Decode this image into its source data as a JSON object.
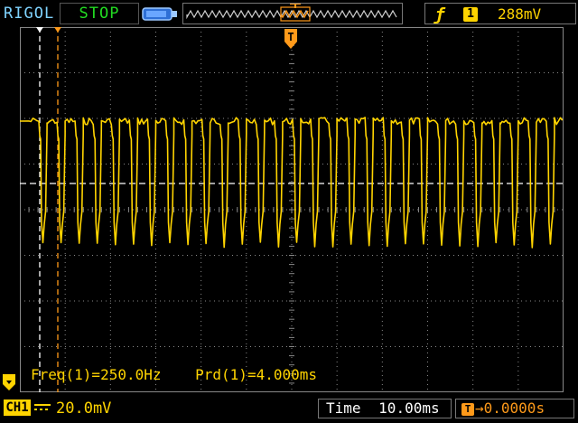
{
  "header": {
    "brand": "RIGOL",
    "run_state": "STOP",
    "trigger_slope_icon": "rising-edge-icon",
    "trigger_source": "1",
    "trigger_level": "288mV"
  },
  "screen_markers": {
    "trigger_position_label": "T"
  },
  "measurements": [
    "Freq(1)=250.0Hz",
    "Prd(1)=4.000ms"
  ],
  "footer": {
    "channel_label": "CH1",
    "channel_scale": "20.0mV",
    "time_label": "Time",
    "time_scale": "10.00ms",
    "time_offset": "0.0000s",
    "time_offset_icon_text": "T"
  },
  "colors": {
    "channel1": "#ffd400",
    "trigger_marker": "#ff9a1a",
    "grid": "#888888",
    "background": "#000000",
    "run_state": "#22dd22",
    "brand": "#7fd3ff"
  },
  "waveform": {
    "frequency_hz": 250,
    "period_ms": 4.0,
    "time_per_div_ms": 10,
    "volts_per_div_mv": 20
  }
}
